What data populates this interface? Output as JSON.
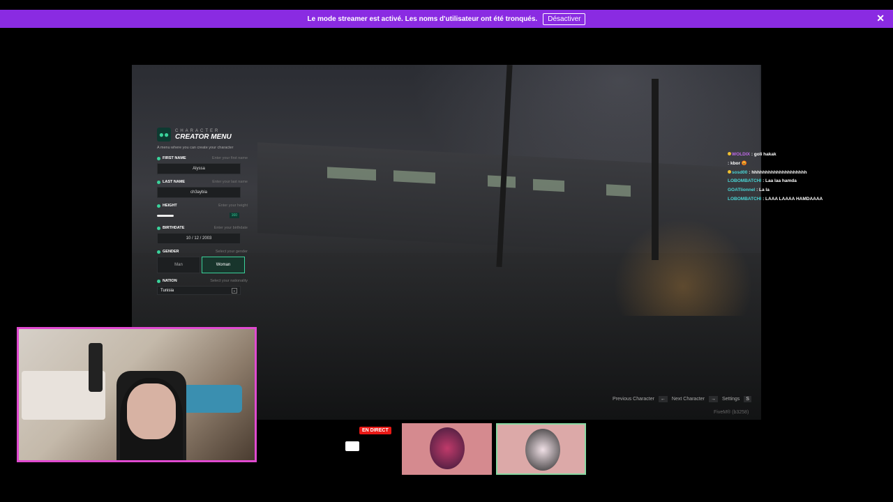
{
  "banner": {
    "message": "Le mode streamer est activé. Les noms d'utilisateur ont été tronqués.",
    "button_label": "Désactiver",
    "close_label": "✕"
  },
  "menu": {
    "title_top": "CHARACTER",
    "title_main": "CREATOR MENU",
    "description": "A menu where you can create your character",
    "first_name": {
      "label": "FIRST NAME",
      "hint": "Enter your first name",
      "value": "Alyssa"
    },
    "last_name": {
      "label": "LAST NAME",
      "hint": "Enter your last name",
      "value": "ch3aybia"
    },
    "height": {
      "label": "HEIGHT",
      "hint": "Enter your height",
      "value": "160"
    },
    "birthdate": {
      "label": "BIRTHDATE",
      "hint": "Enter your birthdate",
      "value": "10 / 12 / 2003"
    },
    "gender": {
      "label": "GENDER",
      "hint": "Select your gender",
      "options": [
        "Man",
        "Woman"
      ],
      "selected": "Woman"
    },
    "nation": {
      "label": "NATION",
      "hint": "Select your nationality",
      "value": "Tunisia"
    }
  },
  "hud": {
    "prev": "Previous Character",
    "prev_key": "←",
    "next": "Next Character",
    "next_key": "→",
    "settings": "Settings",
    "settings_key": "S",
    "fivem": "FiveM® (b3258)"
  },
  "chat": [
    {
      "user": "WOLDIX",
      "text": ": goli hakak"
    },
    {
      "user": "",
      "text": ": kbor 😡"
    },
    {
      "user": "sosd00",
      "text": ": hhhhhhhhhhhhhhhhhhhh"
    },
    {
      "user": "LOBOMBATCHI",
      "text": ": Laa laa hamda"
    },
    {
      "user": "GOATlionnel",
      "text": ": La la"
    },
    {
      "user": "LOBOMBATCHI",
      "text": ": LAAA LAAAA HAMDAAAA"
    }
  ],
  "stream": {
    "live_label": "EN DIRECT"
  }
}
